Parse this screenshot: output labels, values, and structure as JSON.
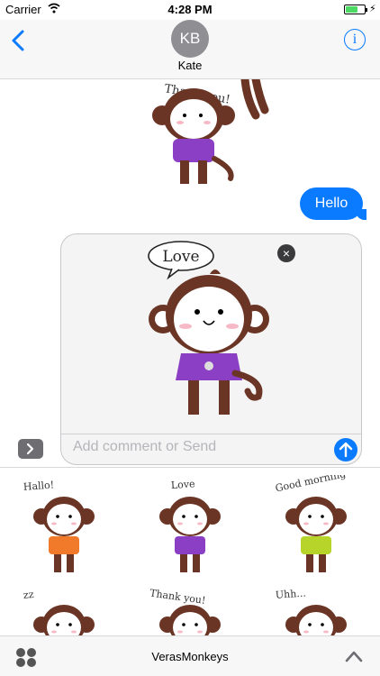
{
  "status_bar": {
    "carrier": "Carrier",
    "time": "4:28 PM"
  },
  "header": {
    "avatar_initials": "KB",
    "contact_name": "Kate",
    "info_glyph": "i"
  },
  "messages": {
    "sent_bubble": "Hello"
  },
  "compose": {
    "placeholder": "Add comment or Send"
  },
  "stickers": {
    "chat_sticker_caption": "Thank you!",
    "preview_caption": "Love",
    "grid": [
      {
        "caption": "Hallo!",
        "shirt": "#f07a2a"
      },
      {
        "caption": "Love",
        "shirt": "#8b3fc4"
      },
      {
        "caption": "Good morning",
        "shirt": "#b6d42a"
      },
      {
        "caption": "zz",
        "shirt": "#4a79d0"
      },
      {
        "caption": "Thank you!",
        "shirt": "#8b3fc4"
      },
      {
        "caption": "Uhh...",
        "shirt": "#8b3fc4"
      }
    ]
  },
  "bottom_bar": {
    "app_name": "VerasMonkeys"
  },
  "colors": {
    "accent": "#0a7aff",
    "monkey_brown": "#6b3525",
    "face": "#ffffff",
    "purple_shirt": "#8b3fc4"
  }
}
